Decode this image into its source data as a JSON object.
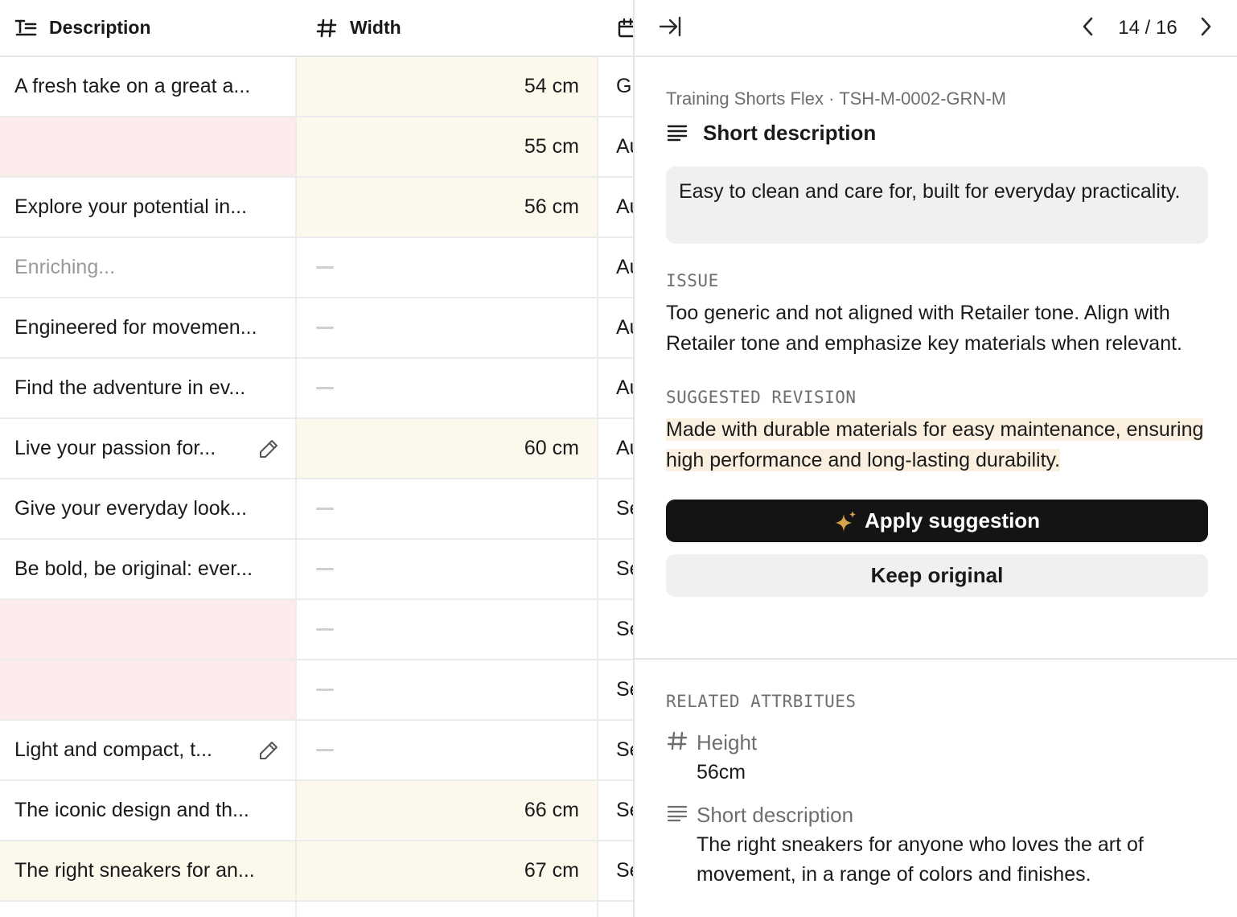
{
  "table": {
    "columns": {
      "description": "Description",
      "width": "Width",
      "date_icon": "calendar-icon"
    },
    "rows": [
      {
        "description": "A fresh take on a great a...",
        "width": "54 cm",
        "col3": "Gr",
        "state": "normal"
      },
      {
        "description": "",
        "width": "55 cm",
        "col3": "Au",
        "state": "error"
      },
      {
        "description": "Explore your potential in...",
        "width": "56 cm",
        "col3": "Au",
        "state": "normal"
      },
      {
        "description": "Enriching...",
        "width": "",
        "col3": "Au",
        "state": "loading"
      },
      {
        "description": "Engineered for movemen...",
        "width": "",
        "col3": "Au",
        "state": "normal"
      },
      {
        "description": "Find the adventure in ev...",
        "width": "",
        "col3": "Au",
        "state": "normal"
      },
      {
        "description": "Live your passion for...",
        "width": "60 cm",
        "col3": "Au",
        "state": "edited"
      },
      {
        "description": "Give your everyday look...",
        "width": "",
        "col3": "Se",
        "state": "normal"
      },
      {
        "description": "Be bold, be original: ever...",
        "width": "",
        "col3": "Se",
        "state": "normal"
      },
      {
        "description": "",
        "width": "",
        "col3": "Se",
        "state": "error"
      },
      {
        "description": "",
        "width": "",
        "col3": "Se",
        "state": "error"
      },
      {
        "description": "Light and compact, t...",
        "width": "",
        "col3": "Se",
        "state": "edited"
      },
      {
        "description": "The iconic design and th...",
        "width": "66 cm",
        "col3": "Se",
        "state": "normal"
      },
      {
        "description": "The right sneakers for an...",
        "width": "67 cm",
        "col3": "Se",
        "state": "selected"
      }
    ]
  },
  "panel": {
    "counter": "14 / 16",
    "breadcrumb": "Training Shorts Flex · TSH-M-0002-GRN-M",
    "attribute_title": "Short description",
    "current_value": "Easy to clean and care for, built for everyday practicality.",
    "issue_label": "ISSUE",
    "issue_text": "Too generic and not aligned with Retailer tone. Align with Retailer tone and emphasize key materials when relevant.",
    "suggestion_label": "SUGGESTED REVISION",
    "suggestion_text": "Made with durable materials for easy maintenance, ensuring high performance and long-lasting durability.",
    "apply_label": "Apply suggestion",
    "keep_label": "Keep original",
    "related_label": "RELATED ATTRBITUES",
    "related": [
      {
        "icon": "hash-icon",
        "name": "Height",
        "value": "56cm"
      },
      {
        "icon": "text-lines-icon",
        "name": "Short description",
        "value": "The right sneakers for anyone who loves the art of movement, in a range of colors and finishes."
      }
    ]
  },
  "colors": {
    "error_cell": "#fcebeb",
    "value_cell": "#fcf8ec",
    "highlight": "#fbf0df",
    "sparkle": "#d8a24a",
    "button_dark": "#141414"
  }
}
